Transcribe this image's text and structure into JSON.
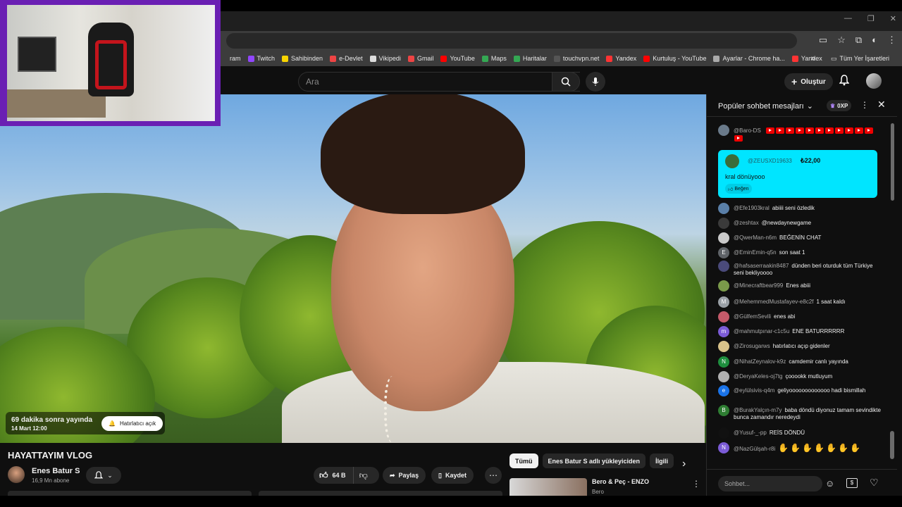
{
  "window": {
    "controls": [
      "—",
      "❐",
      "✕"
    ]
  },
  "bookmarks": {
    "items": [
      {
        "label": "ram",
        "color": "#3c3c3c"
      },
      {
        "label": "Twitch",
        "color": "#9146ff"
      },
      {
        "label": "Sahibinden",
        "color": "#f7d400"
      },
      {
        "label": "e-Devlet",
        "color": "#e44"
      },
      {
        "label": "Vikipedi",
        "color": "#ddd"
      },
      {
        "label": "Gmail",
        "color": "#e44"
      },
      {
        "label": "YouTube",
        "color": "#f00"
      },
      {
        "label": "Maps",
        "color": "#34a853"
      },
      {
        "label": "Haritalar",
        "color": "#34a853"
      },
      {
        "label": "touchvpn.net",
        "color": "#555"
      },
      {
        "label": "Yandex",
        "color": "#f33"
      },
      {
        "label": "Kurtuluş - YouTube",
        "color": "#f00"
      },
      {
        "label": "Ayarlar - Chrome ha...",
        "color": "#aaa"
      },
      {
        "label": "Yandex",
        "color": "#f33"
      }
    ],
    "more": "»",
    "all": "Tüm Yer İşaretleri"
  },
  "header": {
    "search_placeholder": "Ara",
    "create": "Oluştur"
  },
  "video": {
    "live_text": "69 dakika sonra yayında",
    "live_date": "14 Mart 12:00",
    "reminder": "Hatırlatıcı açık",
    "title": "HAYATTAYIM VLOG",
    "channel": "Enes Batur S",
    "subs": "16,9 Mn abone",
    "likes": "64 B",
    "share": "Paylaş",
    "save": "Kaydet",
    "more": "⋯"
  },
  "chips": [
    "Tümü",
    "Enes Batur S adlı yükleyiciden",
    "İlgili"
  ],
  "recommendation": {
    "title": "Bero & Peç - ENZO",
    "channel": "Bero"
  },
  "chat": {
    "title": "Popüler sohbet mesajları",
    "points": "0XP",
    "superchat": {
      "author": "@ZEUSXD19633",
      "amount": "₺22,00",
      "text": "kral dönüyooo",
      "like": "Beğen"
    },
    "top_message": {
      "author": "@Baro-DS"
    },
    "messages": [
      {
        "author": "@Efe1903kral",
        "text": "abiiii seni özledik",
        "color": "#5a7fa8",
        "initial": ""
      },
      {
        "author": "@zeshtax",
        "text": "@newdaynewgame",
        "color": "#3a3a3a",
        "initial": ""
      },
      {
        "author": "@QwerMan-n6m",
        "text": "BEĞENİN CHAT",
        "color": "#c9c9c9",
        "initial": ""
      },
      {
        "author": "@EminEmin-q5n",
        "text": "son saat 1",
        "color": "#5f6368",
        "initial": "E"
      },
      {
        "author": "@hafsaserraakin8487",
        "text": "dünden beri oturduk tüm Türkiye seni bekliyoooo",
        "color": "#4a4a7a",
        "initial": ""
      },
      {
        "author": "@Minecraftbear999",
        "text": "Enes abiii",
        "color": "#7a9a4a",
        "initial": ""
      },
      {
        "author": "@MehemmedMustafayev-e8c2f",
        "text": "1 saat kaldı",
        "color": "#9aa0a6",
        "initial": "M"
      },
      {
        "author": "@GülfemSevili",
        "text": "enes abi",
        "color": "#c45a6a",
        "initial": ""
      },
      {
        "author": "@mahmutpınar-c1c5u",
        "text": "ENE BATURRRRRR",
        "color": "#7b5bd6",
        "initial": "m"
      },
      {
        "author": "@Zirosugarws",
        "text": "hatırlatıcı açıp gidenler",
        "color": "#d9c38a",
        "initial": ""
      },
      {
        "author": "@NihatZeynalov-k9z",
        "text": "camdemir canlı yayında",
        "color": "#1e8e3e",
        "initial": "N"
      },
      {
        "author": "@DeryaKeles-oj7tg",
        "text": "çooookk mutluyum",
        "color": "#b0b0b0",
        "initial": ""
      },
      {
        "author": "@eylülsivis-q4m",
        "text": "geliyooooooooooooo hadi bismillah",
        "color": "#1a73e8",
        "initial": "e"
      },
      {
        "author": "@BurakYalçın-m7y",
        "text": "baba döndü diyonuz tamam sevindikte bunca zamandır neredeydi",
        "color": "#2e7d32",
        "initial": "B"
      },
      {
        "author": "@Yusuf-_-pp",
        "text": "REİS DÖNDÜ",
        "color": "#111",
        "initial": ""
      },
      {
        "author": "@NazGülşah-r8i",
        "text": "",
        "color": "#7b5bd6",
        "initial": "N"
      }
    ],
    "input_placeholder": "Sohbet..."
  }
}
